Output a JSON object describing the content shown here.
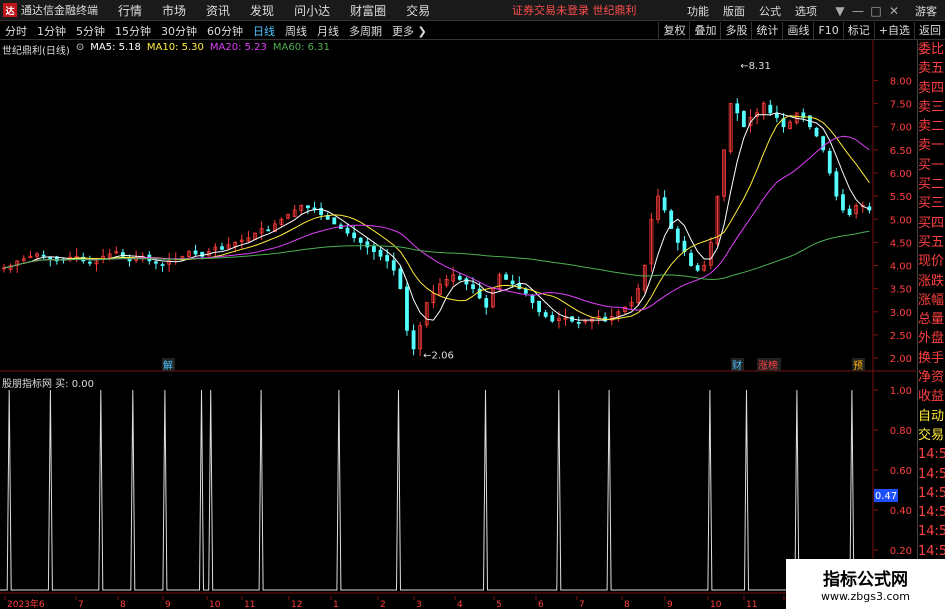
{
  "app": {
    "logo": "达",
    "name": "通达信金融终端",
    "menu": [
      "行情",
      "市场",
      "资讯",
      "发现",
      "问小达",
      "财富圈",
      "交易"
    ],
    "login_status": "证券交易未登录  世纪鼎利",
    "right_menu": [
      "功能",
      "版面",
      "公式",
      "选项"
    ],
    "window_buttons": [
      "▼",
      "—",
      "□",
      "✕"
    ],
    "guest": "游客"
  },
  "periods": {
    "items": [
      "分时",
      "1分钟",
      "5分钟",
      "15分钟",
      "30分钟",
      "60分钟",
      "日线",
      "周线",
      "月线",
      "多周期",
      "更多"
    ],
    "active": "日线"
  },
  "toolbar_right": [
    "复权",
    "叠加",
    "多股",
    "统计",
    "画线",
    "F10",
    "标记",
    "+自选",
    "返回"
  ],
  "main_info": {
    "title": "世纪鼎利(日线)",
    "ma5": "MA5: 5.18",
    "ma10": "MA10: 5.30",
    "ma20": "MA20: 5.23",
    "ma60": "MA60: 6.31"
  },
  "sub_info": "股朋指标网  买: 0.00",
  "side_panel": [
    "委比",
    "卖五",
    "卖四",
    "卖三",
    "卖二",
    "卖一",
    "买一",
    "买二",
    "买三",
    "买四",
    "买五",
    "现价",
    "涨跌",
    "涨幅",
    "总量",
    "外盘",
    "换手",
    "净资",
    "收益",
    "自动",
    "交易",
    "14:5",
    "14:5",
    "14:5",
    "14:5",
    "14:5",
    "14:5",
    "14:5",
    "14:5",
    "14:5"
  ],
  "watermark": {
    "title": "指标公式网",
    "url": "www.zbgs3.com"
  },
  "chart_data": [
    {
      "type": "candlestick",
      "title": "世纪鼎利(日线)",
      "y_ticks": [
        "8.00",
        "7.50",
        "7.00",
        "6.50",
        "6.00",
        "5.50",
        "5.00",
        "4.50",
        "4.00",
        "3.50",
        "3.00",
        "2.50",
        "2.00"
      ],
      "ylim": [
        1.85,
        8.55
      ],
      "annotations": [
        {
          "label": "8.31",
          "y": 8.31
        },
        {
          "label": "2.06",
          "y": 2.06
        }
      ],
      "markers": [
        {
          "label": "解",
          "color": "#4fc3ff"
        },
        {
          "label": "财",
          "color": "#4fc3ff"
        },
        {
          "label": "涨榜",
          "color": "#ff4040"
        },
        {
          "label": "预",
          "color": "#ffb300"
        }
      ],
      "x_dates": [
        "2023年6",
        "7",
        "8",
        "9",
        "10",
        "11",
        "12",
        "1",
        "2",
        "3",
        "4",
        "5",
        "6",
        "7",
        "8",
        "9",
        "10",
        "11",
        "12"
      ],
      "series_close": [
        3.95,
        4.0,
        4.1,
        4.15,
        4.2,
        4.25,
        4.2,
        4.15,
        4.1,
        4.12,
        4.18,
        4.2,
        4.1,
        4.05,
        4.15,
        4.2,
        4.25,
        4.3,
        4.2,
        4.1,
        4.15,
        4.2,
        4.1,
        4.05,
        4.0,
        4.1,
        4.15,
        4.2,
        4.3,
        4.25,
        4.2,
        4.3,
        4.4,
        4.35,
        4.45,
        4.5,
        4.55,
        4.6,
        4.7,
        4.8,
        4.75,
        4.9,
        5.0,
        5.1,
        5.2,
        5.3,
        5.25,
        5.2,
        5.1,
        5.0,
        4.9,
        4.8,
        4.7,
        4.6,
        4.5,
        4.4,
        4.3,
        4.2,
        4.1,
        3.9,
        3.5,
        2.6,
        2.2,
        2.7,
        3.2,
        3.4,
        3.6,
        3.7,
        3.8,
        3.7,
        3.6,
        3.5,
        3.3,
        3.1,
        3.5,
        3.8,
        3.7,
        3.6,
        3.5,
        3.4,
        3.2,
        3.0,
        2.9,
        2.8,
        2.85,
        2.9,
        2.8,
        2.75,
        2.8,
        2.85,
        2.9,
        2.8,
        2.9,
        3.0,
        3.1,
        3.2,
        3.5,
        4.0,
        5.0,
        5.5,
        5.2,
        4.8,
        4.5,
        4.3,
        4.0,
        3.9,
        4.0,
        4.5,
        5.5,
        6.5,
        7.5,
        7.3,
        7.0,
        7.2,
        7.3,
        7.5,
        7.3,
        7.2,
        7.0,
        7.1,
        7.3,
        7.2,
        7.0,
        6.8,
        6.5,
        6.0,
        5.5,
        5.2,
        5.1,
        5.3,
        5.3,
        5.2
      ],
      "series": [
        {
          "name": "MA5",
          "value": 5.18,
          "color": "#ffffff"
        },
        {
          "name": "MA10",
          "value": 5.3,
          "color": "#ffeb3b"
        },
        {
          "name": "MA20",
          "value": 5.23,
          "color": "#e040fb"
        },
        {
          "name": "MA60",
          "value": 6.31,
          "color": "#4caf50"
        }
      ]
    },
    {
      "type": "line",
      "title": "股朋指标网",
      "y_ticks": [
        "1.00",
        "0.80",
        "0.60",
        "0.40",
        "0.20"
      ],
      "ylim": [
        0,
        1.0
      ],
      "current_value_label": "0.47",
      "spike_positions": [
        0.01,
        0.055,
        0.11,
        0.145,
        0.18,
        0.22,
        0.23,
        0.285,
        0.37,
        0.435,
        0.53,
        0.61,
        0.665,
        0.775,
        0.815,
        0.87,
        0.93
      ]
    }
  ]
}
